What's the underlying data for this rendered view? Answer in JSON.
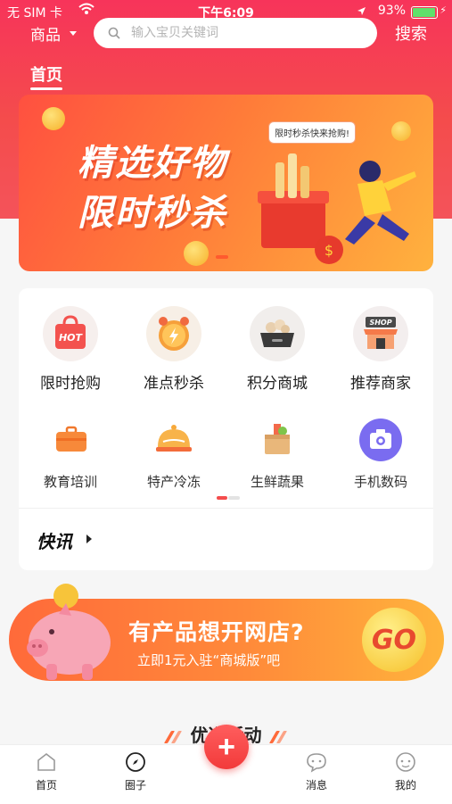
{
  "status_bar": {
    "carrier": "无 SIM 卡",
    "time": "下午6:09",
    "battery": "93%"
  },
  "top": {
    "category": "商品",
    "search_placeholder": "输入宝贝关键词",
    "search_button": "搜索"
  },
  "tab": {
    "home": "首页"
  },
  "banner": {
    "line1": "精选好物",
    "line2": "限时秒杀",
    "bubble": "限时秒杀快来抢购!",
    "coin_symbol": "$"
  },
  "quick_menu": [
    {
      "label": "限时抢购",
      "icon": "hot-bag-icon",
      "badge": "HOT"
    },
    {
      "label": "准点秒杀",
      "icon": "alarm-clock-icon"
    },
    {
      "label": "积分商城",
      "icon": "points-pot-icon"
    },
    {
      "label": "推荐商家",
      "icon": "shop-icon",
      "badge": "SHOP"
    },
    {
      "label": "教育培训",
      "icon": "briefcase-icon"
    },
    {
      "label": "特产冷冻",
      "icon": "food-cover-icon"
    },
    {
      "label": "生鲜蔬果",
      "icon": "produce-box-icon"
    },
    {
      "label": "手机数码",
      "icon": "camera-icon"
    }
  ],
  "news": {
    "label": "快讯"
  },
  "promo": {
    "main": "有产品想开网店?",
    "sub": "立即1元入驻“商城版”吧",
    "go": "GO"
  },
  "section": {
    "title": "优选活动"
  },
  "tabbar": {
    "items": [
      {
        "label": "首页",
        "icon": "home-icon"
      },
      {
        "label": "圈子",
        "icon": "compass-icon"
      },
      {
        "label": "消息",
        "icon": "message-icon"
      },
      {
        "label": "我的",
        "icon": "profile-icon"
      }
    ],
    "add_label": "+"
  },
  "colors": {
    "primary": "#f44c4c",
    "accent_orange": "#ff8a3a",
    "gold": "#f6c02a"
  }
}
